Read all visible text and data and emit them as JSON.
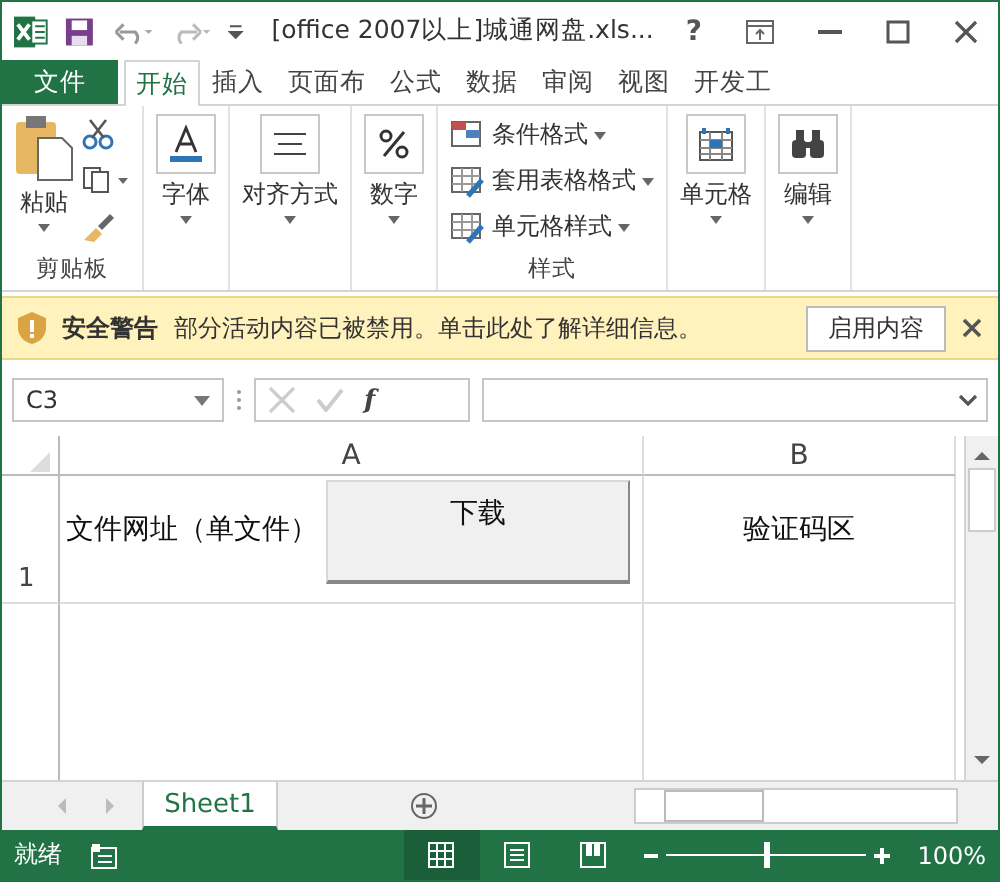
{
  "title_bar": {
    "title": "[office 2007以上]城通网盘.xls...",
    "help": "?"
  },
  "tabs": [
    {
      "label": "文件",
      "kind": "file",
      "selected": false
    },
    {
      "label": "开始",
      "kind": "tab",
      "selected": true
    },
    {
      "label": "插入",
      "kind": "tab",
      "selected": false
    },
    {
      "label": "页面布",
      "kind": "tab",
      "selected": false
    },
    {
      "label": "公式",
      "kind": "tab",
      "selected": false
    },
    {
      "label": "数据",
      "kind": "tab",
      "selected": false
    },
    {
      "label": "审阅",
      "kind": "tab",
      "selected": false
    },
    {
      "label": "视图",
      "kind": "tab",
      "selected": false
    },
    {
      "label": "开发工",
      "kind": "tab",
      "selected": false
    }
  ],
  "ribbon": {
    "clipboard": {
      "paste": "粘贴",
      "label": "剪贴板"
    },
    "groups": [
      {
        "kind": "font",
        "label": "字体"
      },
      {
        "kind": "align",
        "label": "对齐方式"
      },
      {
        "kind": "number",
        "label": "数字"
      }
    ],
    "styles": {
      "items": [
        "条件格式",
        "套用表格格式",
        "单元格样式"
      ],
      "label": "样式"
    },
    "groups2": [
      {
        "kind": "cells",
        "label": "单元格"
      },
      {
        "kind": "edit",
        "label": "编辑"
      }
    ]
  },
  "warning": {
    "title": "安全警告",
    "message": "部分活动内容已被禁用。单击此处了解详细信息。",
    "button": "启用内容"
  },
  "formula_bar": {
    "name_box": "C3",
    "fx": "f"
  },
  "sheet": {
    "columns": [
      "A",
      "B"
    ],
    "rows": [
      {
        "header": "1",
        "cells": [
          "文件网址（单文件）",
          "验证码区"
        ]
      }
    ],
    "button": "下载"
  },
  "sheet_tabs": [
    {
      "label": "Sheet1",
      "selected": true
    }
  ],
  "status_bar": {
    "status": "就绪",
    "views": [
      {
        "kind": "normal",
        "selected": true
      },
      {
        "kind": "layout",
        "selected": false
      },
      {
        "kind": "pagebreak",
        "selected": false
      }
    ],
    "zoom": {
      "level": 0.5,
      "reading": "100%"
    }
  }
}
